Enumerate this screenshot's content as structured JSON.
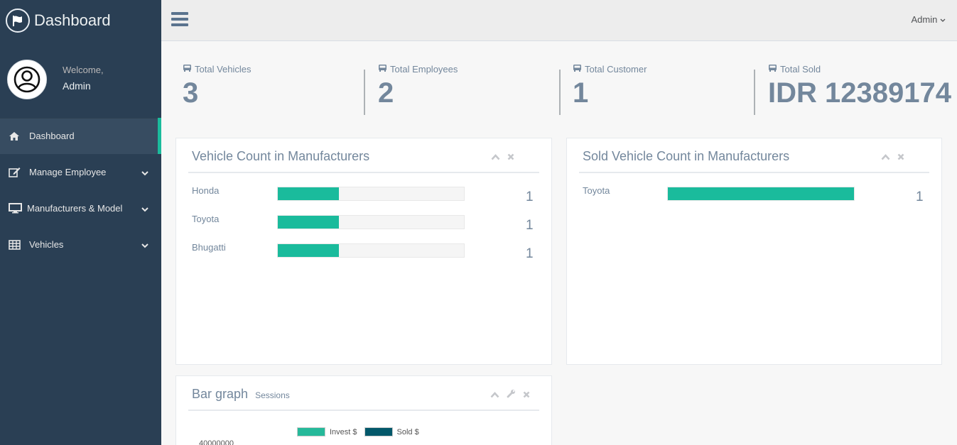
{
  "brand": {
    "title": "Dashboard",
    "icon": "flag-icon"
  },
  "profile": {
    "welcome": "Welcome,",
    "name": "Admin"
  },
  "sidebar": {
    "items": [
      {
        "label": "Dashboard",
        "icon": "home-icon",
        "active": true
      },
      {
        "label": "Manage Employee",
        "icon": "edit-icon"
      },
      {
        "label": "Manufacturers & Model",
        "icon": "desktop-icon"
      },
      {
        "label": "Vehicles",
        "icon": "table-icon"
      }
    ]
  },
  "topnav": {
    "user_label": "Admin"
  },
  "stats": [
    {
      "label": "Total Vehicles",
      "value": "3",
      "icon": "bus-icon"
    },
    {
      "label": "Total Employees",
      "value": "2",
      "icon": "bus-icon"
    },
    {
      "label": "Total Customer",
      "value": "1",
      "icon": "bus-icon"
    },
    {
      "label": "Total Sold",
      "value": "IDR 12389174",
      "icon": "bus-icon"
    }
  ],
  "vehicle_panel": {
    "title": "Vehicle Count in Manufacturers",
    "rows": [
      {
        "label": "Honda",
        "count": "1",
        "fill": 0.33
      },
      {
        "label": "Toyota",
        "count": "1",
        "fill": 0.33
      },
      {
        "label": "Bhugatti",
        "count": "1",
        "fill": 0.33
      }
    ]
  },
  "sold_panel": {
    "title": "Sold Vehicle Count in Manufacturers",
    "rows": [
      {
        "label": "Toyota",
        "count": "1",
        "fill": 1.0
      }
    ]
  },
  "bar_panel": {
    "title": "Bar graph",
    "subtitle": "Sessions",
    "legend": [
      {
        "label": "Invest $",
        "color": "#26b99a"
      },
      {
        "label": "Sold $",
        "color": "#03586a"
      }
    ],
    "top_tick": "40000000"
  },
  "colors": {
    "accent": "#1abb9c",
    "sidebar": "#2a3f54"
  }
}
